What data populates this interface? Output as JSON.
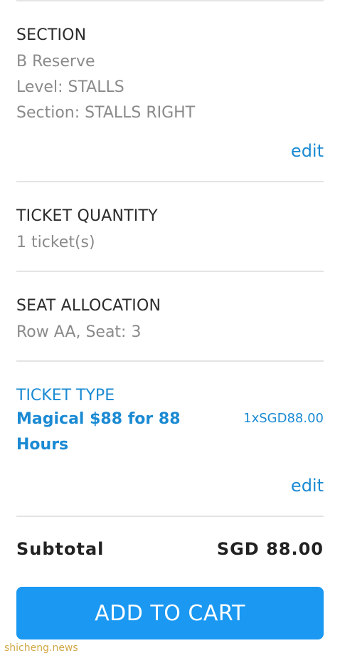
{
  "section": {
    "heading": "SECTION",
    "name": "B Reserve",
    "level": "Level: STALLS",
    "section_detail": "Section: STALLS RIGHT",
    "edit_label": "edit"
  },
  "quantity": {
    "heading": "TICKET QUANTITY",
    "value": "1 ticket(s)"
  },
  "seat": {
    "heading": "SEAT ALLOCATION",
    "value": "Row AA, Seat: 3"
  },
  "ticket_type": {
    "heading": "TICKET TYPE",
    "name": "Magical $88 for 88 Hours",
    "price": "1xSGD88.00",
    "edit_label": "edit"
  },
  "subtotal": {
    "label": "Subtotal",
    "value": "SGD 88.00"
  },
  "cart_button_label": "ADD TO CART",
  "watermark": "shicheng.news",
  "colors": {
    "accent": "#1a8ad3",
    "button": "#1a98f2",
    "muted_text": "#8a8a8a",
    "divider": "#e4e4e4"
  }
}
